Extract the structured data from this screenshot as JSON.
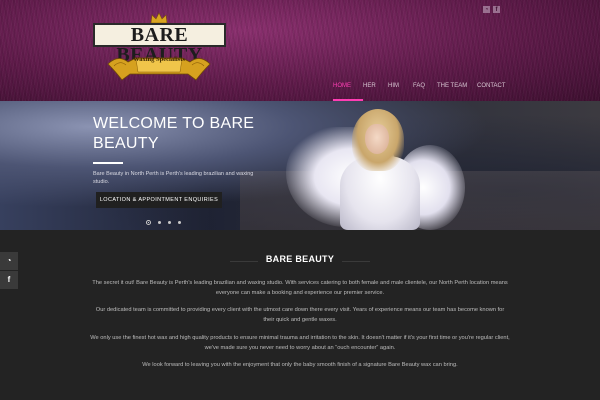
{
  "header": {
    "logo": {
      "title": "BARE BEAUTY",
      "tagline": "Waxing Specialists"
    },
    "social_top": [
      {
        "icon": "rss-icon",
        "glyph": "◔"
      },
      {
        "icon": "facebook-icon",
        "glyph": "f"
      }
    ],
    "nav": [
      {
        "label": "HOME",
        "active": true
      },
      {
        "label": "HER",
        "active": false
      },
      {
        "label": "HIM",
        "active": false
      },
      {
        "label": "FAQ",
        "active": false
      },
      {
        "label": "THE TEAM",
        "active": false
      },
      {
        "label": "CONTACT",
        "active": false
      }
    ]
  },
  "hero": {
    "title": "WELCOME TO BARE BEAUTY",
    "description": "Bare Beauty in North Perth is Perth's leading brazilian and waxing studio.",
    "button_label": "LOCATION & APPOINTMENT ENQUIRIES",
    "slide_count": 4,
    "active_slide": 1
  },
  "side_social": [
    {
      "icon": "rss-icon",
      "glyph": "◔"
    },
    {
      "icon": "facebook-icon",
      "glyph": "f"
    }
  ],
  "main": {
    "section_title": "BARE BEAUTY",
    "paragraphs": [
      "The secret it out! Bare Beauty is Perth's leading brazilian and waxing studio. With services catering to both female and male clientele, our North Perth location means everyone can make a booking and experience our premier service.",
      "Our dedicated team is committed to providing every client with the utmost care down there every visit. Years of experience means our team has become known for their quick and gentle waxes.",
      "We only use the finest hot wax and high quality products to ensure minimal trauma and irritation to the skin. It doesn't matter if it's your first time or you're regular client, we've made sure you never need to worry about an “ouch encounter” again.",
      "We look forward to leaving you with the enjoyment that only the baby smooth finish of a signature Bare Beauty wax can bring."
    ]
  },
  "colors": {
    "accent": "#ff3db4",
    "header_bg": "#5e1a49",
    "body_bg": "#232323",
    "button_bg": "#202020"
  }
}
